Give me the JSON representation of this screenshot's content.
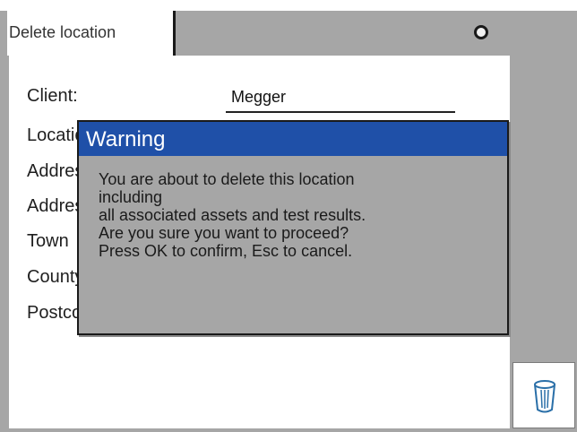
{
  "tab": {
    "label": "Delete location"
  },
  "form": {
    "fields": [
      {
        "label": "Client:",
        "value": "Megger"
      },
      {
        "label": "Location"
      },
      {
        "label": "Address"
      },
      {
        "label": "Address"
      },
      {
        "label": "Town"
      },
      {
        "label": "County"
      },
      {
        "label": "Postcode"
      }
    ]
  },
  "dialog": {
    "title": "Warning",
    "lines": [
      "You are about to delete this location",
      "including",
      "all associated assets and test results.",
      "Are you sure you want to proceed?",
      "Press OK to confirm, Esc to cancel."
    ]
  },
  "icons": {
    "status": "status-indicator-icon",
    "trash": "trash-icon"
  },
  "colors": {
    "frame": "#a6a6a6",
    "dialog_title": "#1f50a8",
    "dialog_bg": "#a6a6a6"
  }
}
